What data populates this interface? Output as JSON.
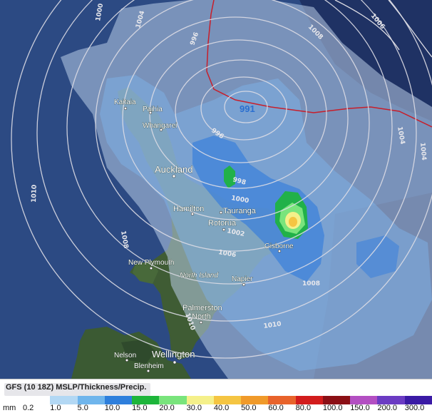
{
  "map": {
    "places": [
      {
        "name": "Kaitaia",
        "cls": "sm"
      },
      {
        "name": "Paihia",
        "cls": "sm"
      },
      {
        "name": "Whangarei",
        "cls": "sm"
      },
      {
        "name": "Auckland",
        "cls": "lg"
      },
      {
        "name": "Hamilton",
        "cls": "md"
      },
      {
        "name": "Tauranga",
        "cls": "md"
      },
      {
        "name": "Rotorua",
        "cls": "md"
      },
      {
        "name": "Gisborne",
        "cls": "md"
      },
      {
        "name": "New Plymouth",
        "cls": "md"
      },
      {
        "name": "North Island",
        "cls": "it"
      },
      {
        "name": "Napier",
        "cls": "md"
      },
      {
        "name": "Palmerston",
        "cls": "md"
      },
      {
        "name": "North",
        "cls": "md"
      },
      {
        "name": "Nelson",
        "cls": "md"
      },
      {
        "name": "Wellington",
        "cls": "lg"
      },
      {
        "name": "Blenheim",
        "cls": "md"
      }
    ],
    "pressure_low": "991",
    "isobar_labels": [
      "996",
      "1004",
      "1000",
      "1006",
      "1008",
      "1010",
      "1004",
      "996",
      "998",
      "1000",
      "1002",
      "1006",
      "1008",
      "1010",
      "1008",
      "1010",
      "1004"
    ]
  },
  "legend": {
    "title": "GFS (10 18Z) MSLP/Thickness/Precip.",
    "unit": "mm",
    "values": [
      "0.2",
      "1.0",
      "5.0",
      "10.0",
      "15.0",
      "20.0",
      "30.0",
      "40.0",
      "50.0",
      "60.0",
      "80.0",
      "100.0",
      "150.0",
      "200.0",
      "300.0"
    ],
    "colors": [
      "#ffffff",
      "#b3d8f4",
      "#6fb5ec",
      "#2e7fdc",
      "#1db53a",
      "#79e47c",
      "#f5f08a",
      "#f5c542",
      "#f09a2a",
      "#e8632b",
      "#d21c1c",
      "#8b0f15",
      "#b34fc2",
      "#6b3bc3",
      "#3a1aa5"
    ]
  }
}
